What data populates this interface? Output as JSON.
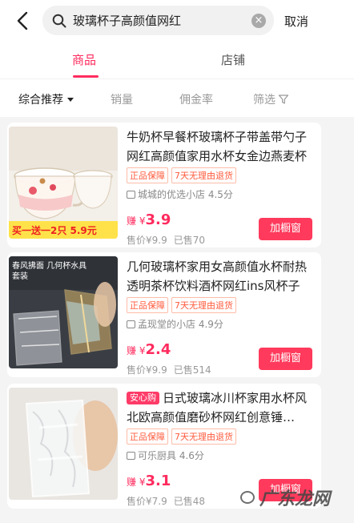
{
  "header": {
    "search_value": "玻璃杯子高颜值网红",
    "cancel_label": "取消"
  },
  "tabs": [
    {
      "label": "商品",
      "active": true
    },
    {
      "label": "店铺",
      "active": false
    }
  ],
  "filters": {
    "default": "综合推荐",
    "sales": "销量",
    "commission": "佣金率",
    "screen": "筛选"
  },
  "products": [
    {
      "badge": "",
      "title": "牛奶杯早餐杯玻璃杯子带盖带勺子网红高颜值家用水杯女金边燕麦杯",
      "tags": [
        "正品保障",
        "7天无理由退货"
      ],
      "shop": "城城的优选小店 4.5分",
      "earn_prefix": "赚 ¥",
      "earn_amount": "3.9",
      "price": "售价¥9.9",
      "sold": "已售70",
      "add_label": "加橱窗",
      "image_caption": "买一送一2只 5.9元"
    },
    {
      "badge": "",
      "title": "几何玻璃杯家用女高颜值水杯耐热透明茶杯饮料酒杯网红ins风杯子",
      "tags": [
        "正品保障",
        "7天无理由退货"
      ],
      "shop": "孟现堂的小店 4.9分",
      "earn_prefix": "赚 ¥",
      "earn_amount": "2.4",
      "price": "售价¥9.9",
      "sold": "已售514",
      "add_label": "加橱窗",
      "image_caption": "春风拂面 几何杯水具套装"
    },
    {
      "badge": "安心购",
      "title": "日式玻璃冰川杯家用水杯风北欧高颜值磨砂杯网红创意锤…",
      "tags": [
        "正品保障",
        "7天无理由退货"
      ],
      "shop": "可乐厨具 4.6分",
      "earn_prefix": "赚 ¥",
      "earn_amount": "3.1",
      "price": "售价¥7.9",
      "sold": "已售48",
      "add_label": "加橱窗",
      "image_caption": ""
    }
  ],
  "watermark": "广东龙网",
  "colors": {
    "accent": "#ff2b5e",
    "button": "#ff3a5c",
    "tag": "#ff5a3c"
  }
}
